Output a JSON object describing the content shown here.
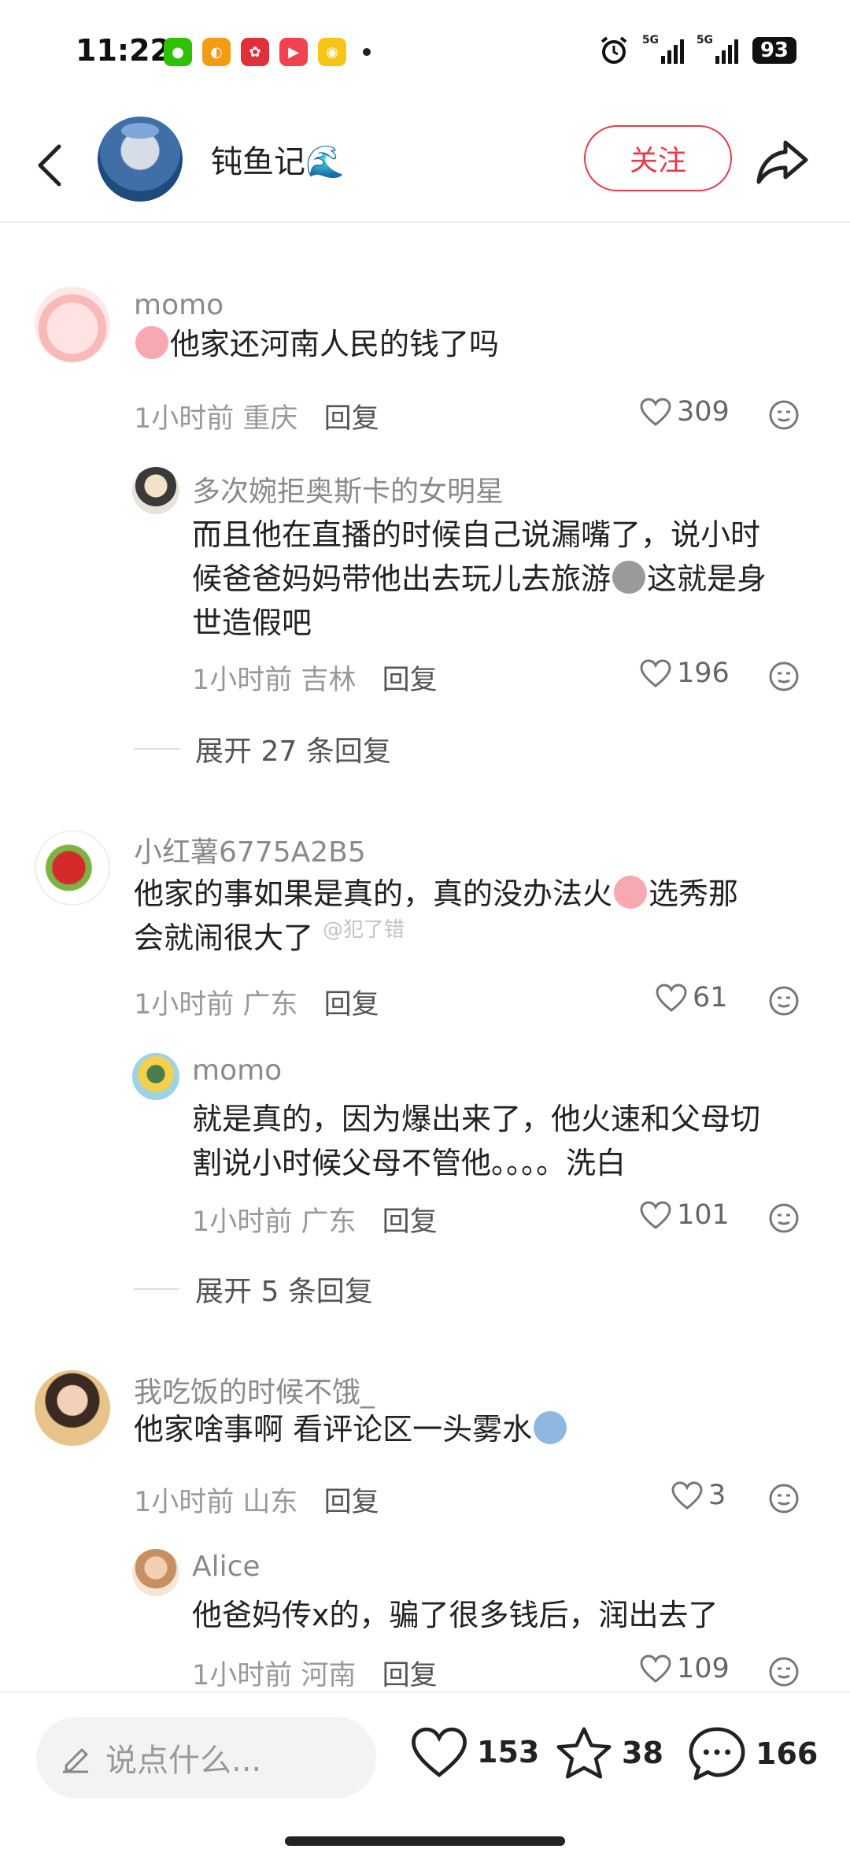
{
  "status_bar": {
    "time": "11:22",
    "network_1": "5G",
    "network_2": "5G",
    "battery": "93"
  },
  "header": {
    "author_name": "钝鱼记🌊",
    "follow_label": "关注"
  },
  "comments": [
    {
      "name": "momo",
      "text_after_emoji": "他家还河南人民的钱了吗",
      "time": "1小时前",
      "location": "重庆",
      "reply_label": "回复",
      "likes": "309",
      "reply": {
        "name": "多次婉拒奥斯卡的女明星",
        "text_line1": "而且他在直播的时候自己说漏嘴了，说小时",
        "text_line2a": "候爸爸妈妈带他出去玩儿去旅游",
        "text_line2b": "这就是身",
        "text_line3": "世造假吧",
        "time": "1小时前",
        "location": "吉林",
        "reply_label": "回复",
        "likes": "196"
      },
      "expand_label": "展开 27 条回复"
    },
    {
      "name": "小红薯6775A2B5",
      "text_line1a": "他家的事如果是真的，真的没办法火",
      "text_line1b": "选秀那",
      "text_line2": "会就闹很大了",
      "time": "1小时前",
      "location": "广东",
      "reply_label": "回复",
      "likes": "61",
      "reply": {
        "name": "momo",
        "text_line1": "就是真的，因为爆出来了，他火速和父母切",
        "text_line2": "割说小时候父母不管他。。。。洗白",
        "time": "1小时前",
        "location": "广东",
        "reply_label": "回复",
        "likes": "101"
      },
      "expand_label": "展开 5 条回复"
    },
    {
      "name": "我吃饭的时候不饿_",
      "text": "他家啥事啊 看评论区一头雾水",
      "time": "1小时前",
      "location": "山东",
      "reply_label": "回复",
      "likes": "3",
      "reply": {
        "name": "Alice",
        "text": "他爸妈传x的，骗了很多钱后，润出去了",
        "time": "1小时前",
        "location": "河南",
        "reply_label": "回复",
        "likes": "109"
      }
    }
  ],
  "watermark": "@犯了错",
  "bottom_bar": {
    "input_placeholder": "说点什么...",
    "like_count": "153",
    "collect_count": "38",
    "comment_count": "166"
  },
  "colors": {
    "accent": "#e8394d",
    "meta_gray": "#999999",
    "name_gray": "#8a8a8a"
  }
}
